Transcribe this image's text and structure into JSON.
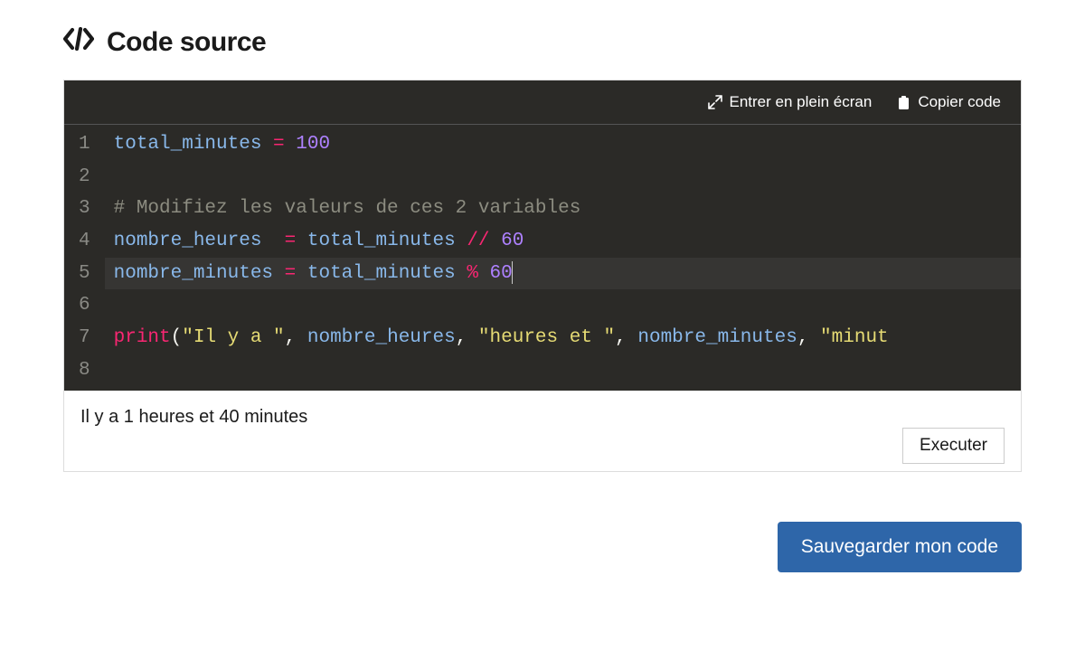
{
  "header": {
    "title": "Code source"
  },
  "toolbar": {
    "fullscreen_label": "Entrer en plein écran",
    "copy_label": "Copier code"
  },
  "editor": {
    "line_numbers": [
      "1",
      "2",
      "3",
      "4",
      "5",
      "6",
      "7",
      "8"
    ],
    "code_lines": [
      [
        {
          "cls": "tok-var",
          "t": "total_minutes"
        },
        {
          "cls": "tok-plain",
          "t": " "
        },
        {
          "cls": "tok-op",
          "t": "="
        },
        {
          "cls": "tok-plain",
          "t": " "
        },
        {
          "cls": "tok-num",
          "t": "100"
        }
      ],
      [],
      [
        {
          "cls": "tok-com",
          "t": "# Modifiez les valeurs de ces 2 variables"
        }
      ],
      [
        {
          "cls": "tok-var",
          "t": "nombre_heures"
        },
        {
          "cls": "tok-plain",
          "t": "  "
        },
        {
          "cls": "tok-op",
          "t": "="
        },
        {
          "cls": "tok-plain",
          "t": " "
        },
        {
          "cls": "tok-var",
          "t": "total_minutes"
        },
        {
          "cls": "tok-plain",
          "t": " "
        },
        {
          "cls": "tok-op",
          "t": "//"
        },
        {
          "cls": "tok-plain",
          "t": " "
        },
        {
          "cls": "tok-num",
          "t": "60"
        }
      ],
      [
        {
          "cls": "tok-var",
          "t": "nombre_minutes"
        },
        {
          "cls": "tok-plain",
          "t": " "
        },
        {
          "cls": "tok-op",
          "t": "="
        },
        {
          "cls": "tok-plain",
          "t": " "
        },
        {
          "cls": "tok-var",
          "t": "total_minutes"
        },
        {
          "cls": "tok-plain",
          "t": " "
        },
        {
          "cls": "tok-op",
          "t": "%"
        },
        {
          "cls": "tok-plain",
          "t": " "
        },
        {
          "cls": "tok-num",
          "t": "60"
        }
      ],
      [],
      [
        {
          "cls": "tok-call",
          "t": "print"
        },
        {
          "cls": "tok-punc",
          "t": "("
        },
        {
          "cls": "tok-str",
          "t": "\"Il y a \""
        },
        {
          "cls": "tok-punc",
          "t": ", "
        },
        {
          "cls": "tok-var",
          "t": "nombre_heures"
        },
        {
          "cls": "tok-punc",
          "t": ", "
        },
        {
          "cls": "tok-str",
          "t": "\"heures et \""
        },
        {
          "cls": "tok-punc",
          "t": ", "
        },
        {
          "cls": "tok-var",
          "t": "nombre_minutes"
        },
        {
          "cls": "tok-punc",
          "t": ", "
        },
        {
          "cls": "tok-str",
          "t": "\"minut"
        }
      ],
      []
    ],
    "selected_line_index": 4,
    "cursor_line_index": 4
  },
  "output": {
    "text": "Il y a  1 heures et  40 minutes"
  },
  "buttons": {
    "execute_label": "Executer",
    "save_label": "Sauvegarder mon code"
  }
}
